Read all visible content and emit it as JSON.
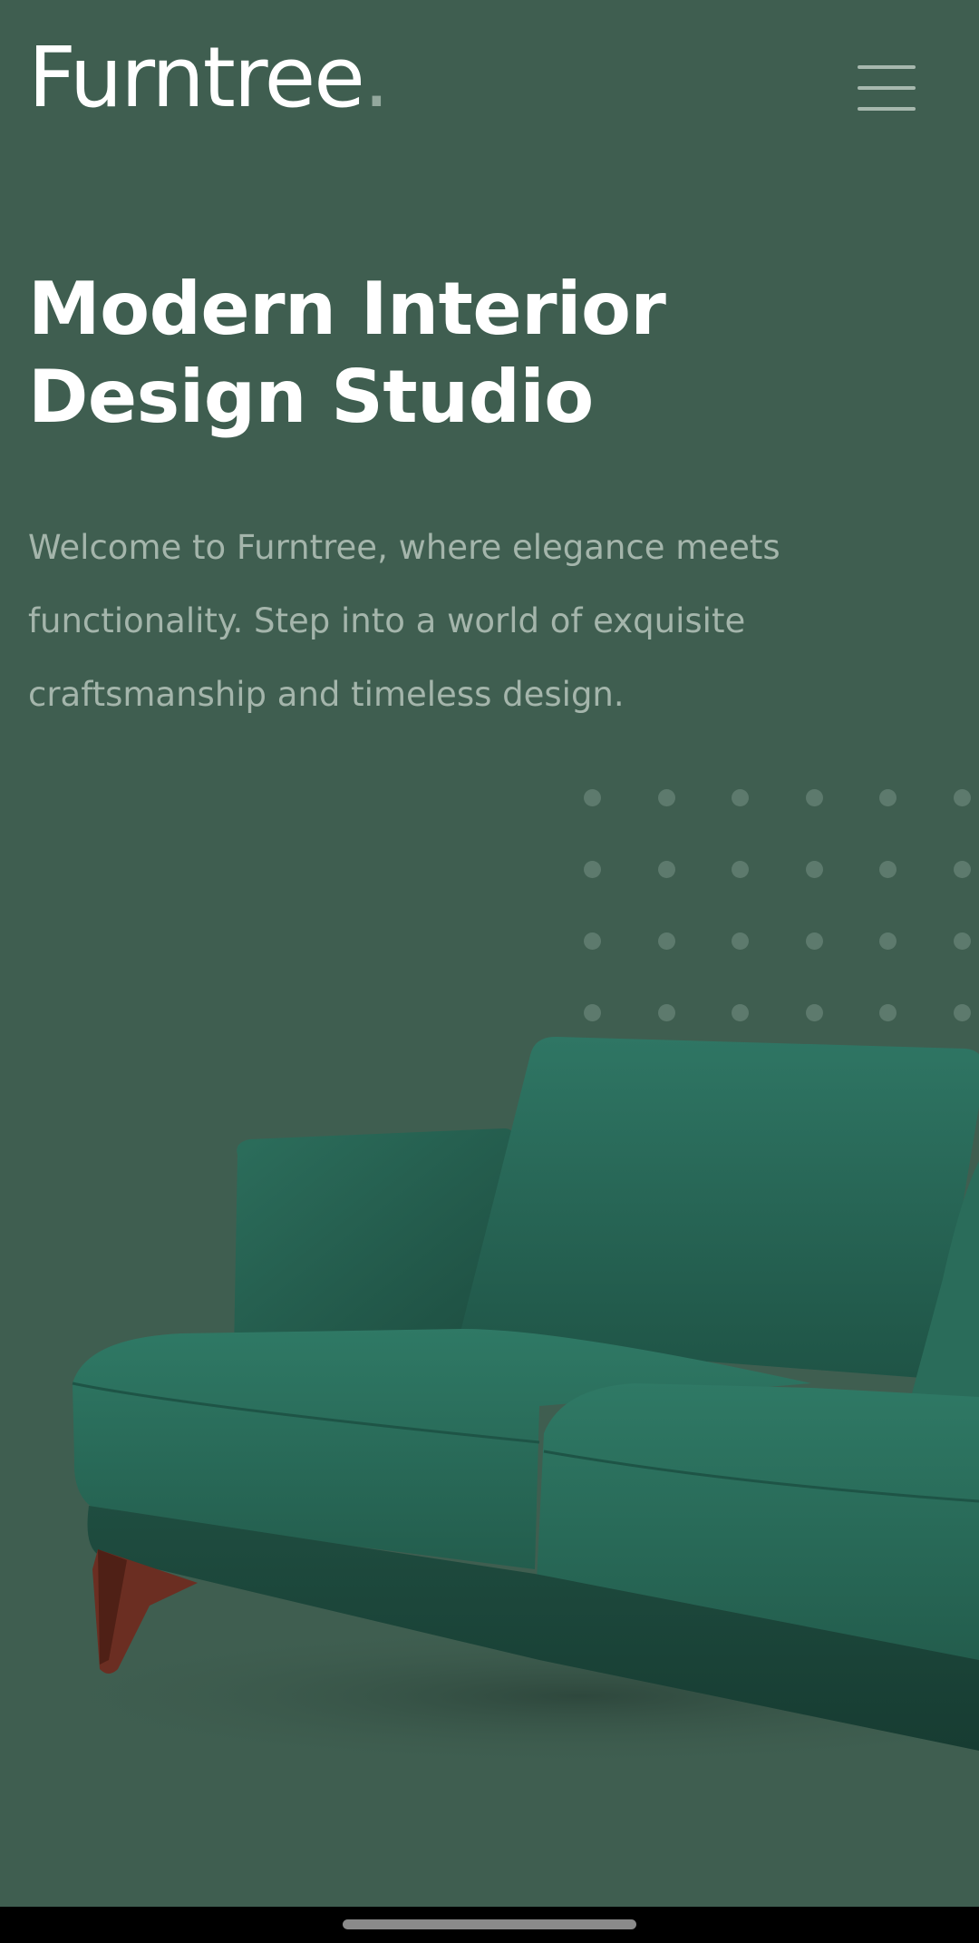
{
  "header": {
    "logo_text": "Furntree",
    "logo_dot": ".",
    "menu_icon": "hamburger-menu-icon"
  },
  "hero": {
    "title": "Modern Interior Design Studio",
    "description": "Welcome to Furntree, where elegance meets functionality. Step into a world of exquisite craftsmanship and timeless design."
  },
  "decor": {
    "dot_grid_icon": "dot-grid-pattern",
    "image_subject": "green-velvet-sofa"
  },
  "colors": {
    "background": "#3f5e50",
    "logo_dot": "#93a89d",
    "description_text": "#a4b5ab",
    "sofa_velvet": "#2e6f5e",
    "sofa_leg": "#6b2e22"
  }
}
